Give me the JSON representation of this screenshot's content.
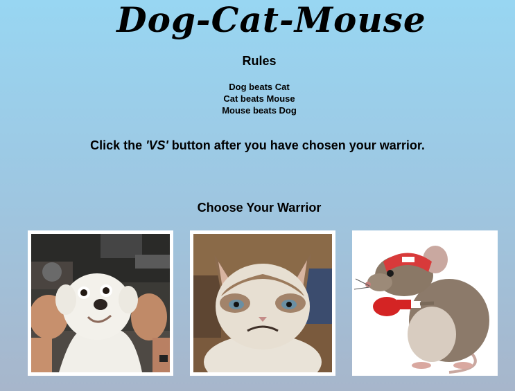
{
  "header": {
    "title": "Dog-Cat-Mouse"
  },
  "rules": {
    "heading": "Rules",
    "items": [
      "Dog beats Cat",
      "Cat beats Mouse",
      "Mouse beats Dog"
    ]
  },
  "instruction": {
    "before": "Click the ",
    "emphasis": "'VS'",
    "after": " button after you have chosen your warrior."
  },
  "warriors": {
    "heading": "Choose Your Warrior",
    "options": [
      {
        "name": "dog"
      },
      {
        "name": "cat"
      },
      {
        "name": "mouse"
      }
    ]
  }
}
